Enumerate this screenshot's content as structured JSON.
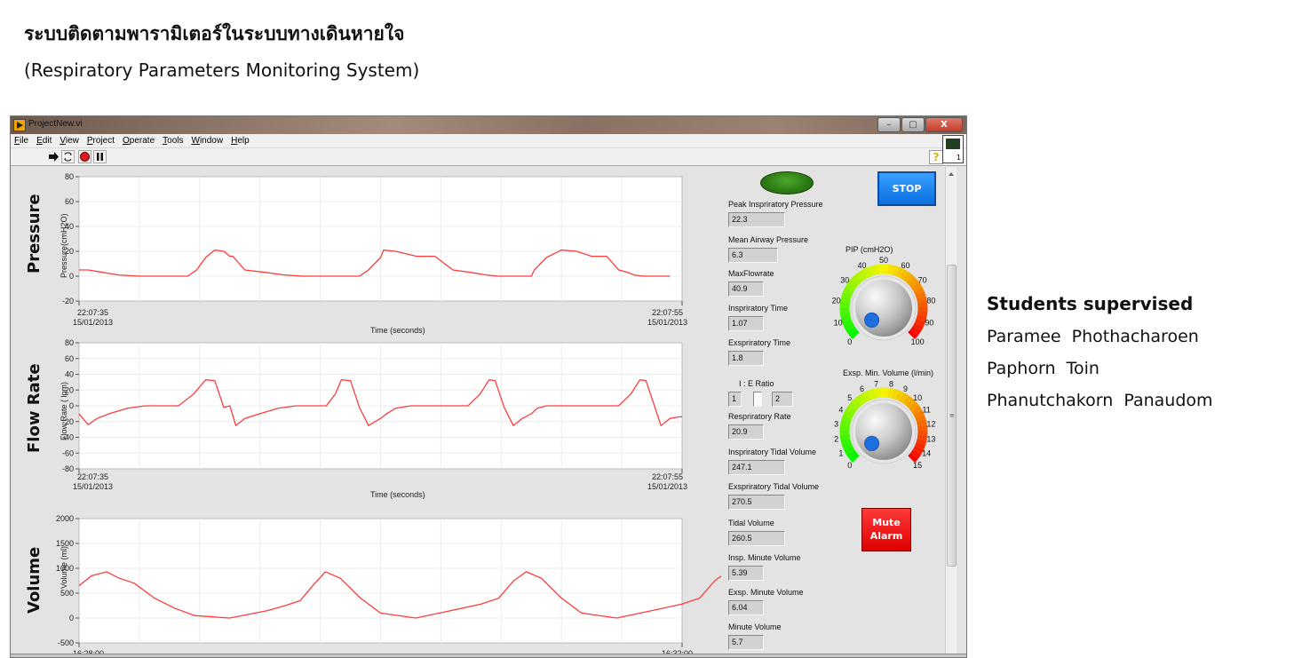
{
  "slide": {
    "title_thai": "ระบบติดตามพารามิเตอร์ในระบบทางเดินหายใจ",
    "subtitle": "(Respiratory Parameters Monitoring System)"
  },
  "window": {
    "title": "ProjectNew.vi",
    "minimize_label": "–",
    "maximize_label": "▢",
    "close_label": "X",
    "menu": [
      "File",
      "Edit",
      "View",
      "Project",
      "Operate",
      "Tools",
      "Window",
      "Help"
    ],
    "toolbar": {
      "run_icon": "run-arrow-icon",
      "run_continuous_icon": "run-continuously-icon",
      "abort_icon": "abort-icon",
      "pause_icon": "pause-icon",
      "help_label": "?",
      "vi_icon_number": "1"
    }
  },
  "controls": {
    "stop_label": "STOP",
    "mute_label_line1": "Mute",
    "mute_label_line2": "Alarm",
    "led_color": "#2e7d14",
    "accent_blue": "#0a6fe0",
    "alarm_red": "#e00000"
  },
  "indicators": [
    {
      "label": "Peak  Inspriratory  Pressure",
      "value": "22.3"
    },
    {
      "label": "Mean Airway Pressure",
      "value": "6.3"
    },
    {
      "label": "MaxFlowrate",
      "value": "40.9"
    },
    {
      "label": "Inspriratory  Time",
      "value": "1.07"
    },
    {
      "label": "Exspriratory  Time",
      "value": "1.8"
    },
    {
      "label": "Respriratory Rate",
      "value": "20.9"
    },
    {
      "label": "Inspriratory Tidal  Volume",
      "value": "247.1"
    },
    {
      "label": "Exspriratory Tidal  Volume",
      "value": "270.5"
    },
    {
      "label": "Tidal Volume",
      "value": "260.5"
    },
    {
      "label": "Insp.  Minute Volume",
      "value": "5.39"
    },
    {
      "label": "Exsp. Minute Volume",
      "value": "6.04"
    },
    {
      "label": "Minute Volume",
      "value": "5.7"
    }
  ],
  "ie_ratio": {
    "label": "I : E Ratio",
    "i": "1",
    "e": "2"
  },
  "gauges": [
    {
      "title": "PIP (cmH2O)",
      "min": 0,
      "max": 100,
      "ticks": [
        "0",
        "10",
        "20",
        "30",
        "40",
        "50",
        "60",
        "70",
        "80",
        "90",
        "100"
      ],
      "value": 0
    },
    {
      "title": "Exsp. Min. Volume (l/min)",
      "min": 0,
      "max": 15,
      "ticks": [
        "0",
        "1",
        "2",
        "3",
        "4",
        "5",
        "6",
        "7",
        "8",
        "9",
        "10",
        "11",
        "12",
        "13",
        "14",
        "15"
      ],
      "value": 0
    }
  ],
  "students": {
    "heading": "Students supervised",
    "names": [
      "Paramee  Phothacharoen",
      "Paphorn  Toin",
      "Phanutchakorn  Panaudom"
    ]
  },
  "chart_data": [
    {
      "type": "line",
      "title": "Pressure",
      "ylabel": "Pressure(cmH2O)",
      "xlabel": "Time (seconds)",
      "ylim": [
        -20,
        80
      ],
      "yticks": [
        "80",
        "60",
        "40",
        "20",
        "0",
        "-20"
      ],
      "x_start": {
        "time": "22:07:35",
        "date": "15/01/2013"
      },
      "x_end": {
        "time": "22:07:55",
        "date": "15/01/2013"
      },
      "xlim": [
        0,
        20
      ],
      "grid": true,
      "color": "#ff3b3b",
      "x": [
        0,
        0.3,
        0.8,
        1.3,
        2.0,
        2.4,
        3.2,
        3.6,
        3.9,
        4.2,
        4.5,
        4.8,
        5.0,
        5.1,
        5.5,
        6.2,
        6.8,
        7.4,
        8.0,
        8.6,
        9.0,
        9.3,
        9.6,
        10.0,
        10.1,
        10.5,
        11.2,
        11.8,
        12.4,
        13.0,
        13.5,
        13.9,
        14.2,
        14.4,
        14.7,
        15.0,
        15.1,
        15.5,
        16.0,
        16.5,
        17.0,
        17.5,
        17.9,
        18.2,
        18.4,
        18.7,
        19.0,
        19.1,
        19.6
      ],
      "series": [
        {
          "name": "Pressure",
          "values": [
            5,
            5,
            3,
            1,
            0,
            0,
            0,
            0,
            5,
            15,
            21,
            20,
            16,
            16,
            5,
            3,
            1,
            0,
            0,
            0,
            0,
            0,
            5,
            15,
            21,
            20,
            16,
            16,
            5,
            3,
            1,
            0,
            0,
            0,
            0,
            0,
            5,
            15,
            21,
            20,
            16,
            16,
            5,
            3,
            1,
            0,
            0,
            0,
            0
          ]
        }
      ]
    },
    {
      "type": "line",
      "title": "Flow Rate",
      "ylabel": "Flow Rate ( lpm)",
      "xlabel": "Time (seconds)",
      "ylim": [
        -80,
        80
      ],
      "yticks": [
        "80",
        "60",
        "40",
        "20",
        "0",
        "-20",
        "-40",
        "-60",
        "-80"
      ],
      "x_start": {
        "time": "22:07:35",
        "date": "15/01/2013"
      },
      "x_end": {
        "time": "22:07:55",
        "date": "15/01/2013"
      },
      "xlim": [
        0,
        20
      ],
      "grid": true,
      "color": "#ff3b3b",
      "x": [
        0,
        0.3,
        0.6,
        1.0,
        1.6,
        2.2,
        2.8,
        3.3,
        3.8,
        4.2,
        4.5,
        4.8,
        5.0,
        5.2,
        5.5,
        6.0,
        6.6,
        7.2,
        7.8,
        8.2,
        8.5,
        8.7,
        9.0,
        9.3,
        9.6,
        10.0,
        10.2,
        10.5,
        11.0,
        11.6,
        12.3,
        12.9,
        13.3,
        13.6,
        13.8,
        14.1,
        14.4,
        14.7,
        15.0,
        15.2,
        15.5,
        16.0,
        16.6,
        17.3,
        17.9,
        18.3,
        18.6,
        18.8,
        19.1,
        19.3,
        19.6,
        19.9,
        20.0
      ],
      "series": [
        {
          "name": "Flow Rate",
          "values": [
            -10,
            -24,
            -16,
            -10,
            -3,
            0,
            0,
            0,
            15,
            33,
            32,
            -2,
            0,
            -25,
            -16,
            -10,
            -3,
            0,
            0,
            0,
            15,
            33,
            32,
            -2,
            -25,
            -16,
            -10,
            -3,
            0,
            0,
            0,
            0,
            15,
            33,
            32,
            -2,
            -25,
            -16,
            -10,
            -3,
            0,
            0,
            0,
            0,
            0,
            15,
            33,
            32,
            -2,
            -25,
            -16,
            -14,
            -14
          ]
        }
      ]
    },
    {
      "type": "line",
      "title": "Volume",
      "ylabel": "Volume (ml)",
      "xlabel": "",
      "ylim": [
        -500,
        2000
      ],
      "yticks": [
        "2000",
        "1500",
        "1000",
        "500",
        "0",
        "-500"
      ],
      "x_start": {
        "time": "16:28:00",
        "date": ""
      },
      "x_end": {
        "time": "16:32:00",
        "date": ""
      },
      "xlim": [
        0,
        240
      ],
      "grid": true,
      "color": "#ff3b3b",
      "x": [
        0,
        5,
        11,
        16,
        22,
        30,
        38,
        46,
        60,
        75,
        82,
        88,
        93,
        98,
        104,
        112,
        120,
        134,
        148,
        160,
        167,
        173,
        178,
        184,
        192,
        200,
        214,
        228,
        240,
        247,
        253,
        258,
        264,
        272,
        280,
        294,
        308,
        320,
        327,
        333,
        338,
        344,
        352,
        360,
        375,
        390,
        402,
        410,
        416,
        420,
        428,
        436,
        440
      ],
      "series": [
        {
          "name": "Volume",
          "values": [
            650,
            850,
            930,
            800,
            700,
            400,
            200,
            50,
            0,
            150,
            250,
            350,
            650,
            930,
            800,
            400,
            100,
            0,
            150,
            280,
            400,
            750,
            930,
            800,
            400,
            100,
            0,
            150,
            280,
            400,
            750,
            930,
            800,
            400,
            100,
            0,
            150,
            280,
            400,
            750,
            930,
            800,
            400,
            100,
            0,
            150,
            280,
            400,
            750,
            930,
            700,
            300,
            100
          ]
        }
      ]
    }
  ]
}
